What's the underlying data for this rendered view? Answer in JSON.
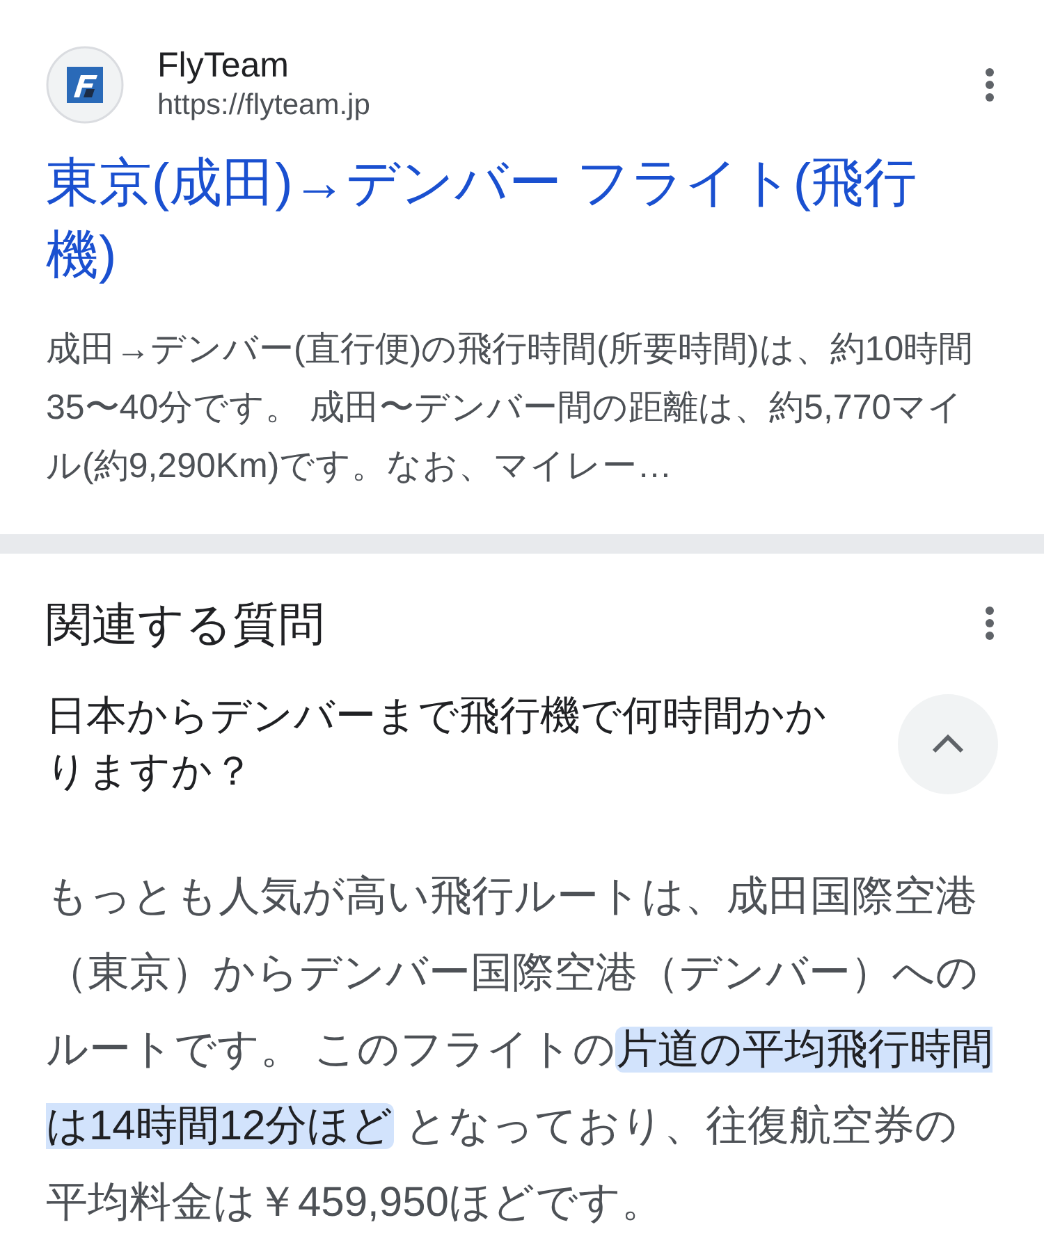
{
  "result": {
    "site_name": "FlyTeam",
    "url": "https://flyteam.jp",
    "title": "東京(成田)→デンバー フライト(飛行機)",
    "snippet": "成田→デンバー(直行便)の飛行時間(所要時間)は、約10時間35〜40分です。 成田〜デンバー間の距離は、約5,770マイル(約9,290Km)です。なお、マイレー…"
  },
  "related": {
    "heading": "関連する質問",
    "questions": [
      {
        "question": "日本からデンバーまで飛行機で何時間かかりますか？",
        "expanded": true,
        "answer": [
          {
            "text": "もっとも人気が高い飛行ルートは、成田国際空港（東京）からデンバー国際空港（デンバー）へのルートです。 このフライトの",
            "highlighted": false
          },
          {
            "text": "片道の平均飛行時間は14時間12分ほど",
            "highlighted": true
          },
          {
            "text": " となっており、往復航空券の平均料金は￥459,950ほどです。",
            "highlighted": false
          }
        ]
      }
    ]
  }
}
